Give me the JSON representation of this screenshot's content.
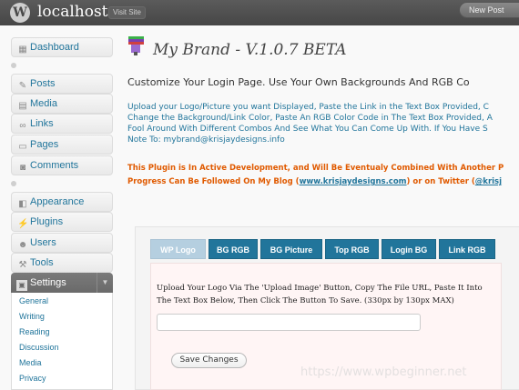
{
  "header": {
    "site_title": "localhost",
    "visit_site": "Visit Site",
    "new_post": "New Post",
    "logo_icon": "wordpress-logo-icon"
  },
  "sidebar": {
    "items": [
      {
        "label": "Dashboard",
        "icon": "dashboard-icon"
      },
      {
        "label": "Posts",
        "icon": "pin-icon"
      },
      {
        "label": "Media",
        "icon": "media-icon"
      },
      {
        "label": "Links",
        "icon": "link-icon"
      },
      {
        "label": "Pages",
        "icon": "pages-icon"
      },
      {
        "label": "Comments",
        "icon": "comment-icon"
      },
      {
        "label": "Appearance",
        "icon": "appearance-icon"
      },
      {
        "label": "Plugins",
        "icon": "plug-icon"
      },
      {
        "label": "Users",
        "icon": "users-icon"
      },
      {
        "label": "Tools",
        "icon": "wrench-icon"
      }
    ],
    "settings": {
      "label": "Settings",
      "submenu": [
        "General",
        "Writing",
        "Reading",
        "Discussion",
        "Media",
        "Privacy"
      ]
    }
  },
  "main": {
    "title": "My Brand - V.1.0.7 BETA",
    "subtitle": "Customize Your Login Page. Use Your Own Backgrounds And RGB Co",
    "description": [
      "Upload your Logo/Picture you want Displayed, Paste the Link in the Text Box Provided, C",
      "Change the Background/Link Color, Paste An RGB Color Code in The Text Box Provided, A",
      "Fool Around With Different Combos And See What You Can Come Up With. If You Have S",
      "Note To: mybrand@krisjaydesigns.info"
    ],
    "dev_notice_1": "This Plugin is In Active Development, and Will Be Eventualy Combined With Another P",
    "dev_notice_2_prefix": "Progress Can Be Followed On My Blog (",
    "blog_link": "www.krisjaydesigns.com",
    "dev_notice_2_middle": ") or on Twitter (",
    "twitter_link": "@krisj"
  },
  "tabs": [
    "WP Logo",
    "BG RGB",
    "BG Picture",
    "Top RGB",
    "Login BG",
    "Link RGB"
  ],
  "panel": {
    "instruction_1": "Upload Your Logo Via The 'Upload Image' Button, Copy The File URL, Paste It Into",
    "instruction_2": "The Text Box Below, Then Click The Button To Save. (330px by 130px MAX)",
    "input_value": "",
    "save_button": "Save Changes"
  },
  "watermark": "https://www.wpbeginner.net",
  "colors": {
    "link": "#21759b",
    "notice": "#e05a00",
    "header_bg": "#464646",
    "tab_active": "#b5cfe0"
  }
}
